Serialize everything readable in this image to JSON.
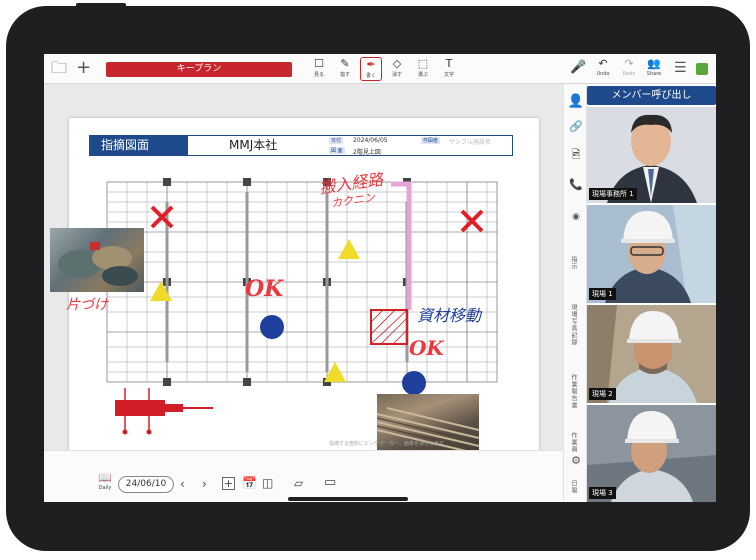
{
  "toolbar": {
    "title": "キープラン",
    "tools": [
      "見る",
      "指す",
      "書く",
      "消す",
      "選ぶ",
      "文字"
    ],
    "right": [
      "Undo",
      "Redo",
      "Share"
    ]
  },
  "document": {
    "heading": "指摘図面",
    "company": "MMJ本社",
    "meta": {
      "label_date": "日付",
      "date": "2024/06/05",
      "label_drawing": "図 面",
      "drawing": "2階見上図",
      "label_other": "作図者",
      "other": "サンプル施設名"
    },
    "footnote": "指摘する箇所にピンやマーカー、画像を添付します"
  },
  "annotations": {
    "tidy": "片づけ",
    "route": "搬入経路",
    "route_sub": "カクニン",
    "material": "資材移動",
    "ok1": "OK",
    "ok2": "OK"
  },
  "bottombar": {
    "daily_label": "Daily",
    "date": "24/06/10"
  },
  "sidebar": {
    "labels": [
      "指示",
      "現場写真記録",
      "作業報告書",
      "作業員",
      "日報"
    ]
  },
  "video": {
    "call_button": "メンバー呼び出し",
    "participants": [
      {
        "label": "現場事務所 1"
      },
      {
        "label": "現場 1"
      },
      {
        "label": "現場 2"
      },
      {
        "label": "現場 3"
      }
    ]
  },
  "colors": {
    "accent_red": "#c8262d",
    "brand_blue": "#1e4a8c",
    "marker_yellow": "#f0dc28",
    "marker_blue": "#1f3f9c"
  }
}
